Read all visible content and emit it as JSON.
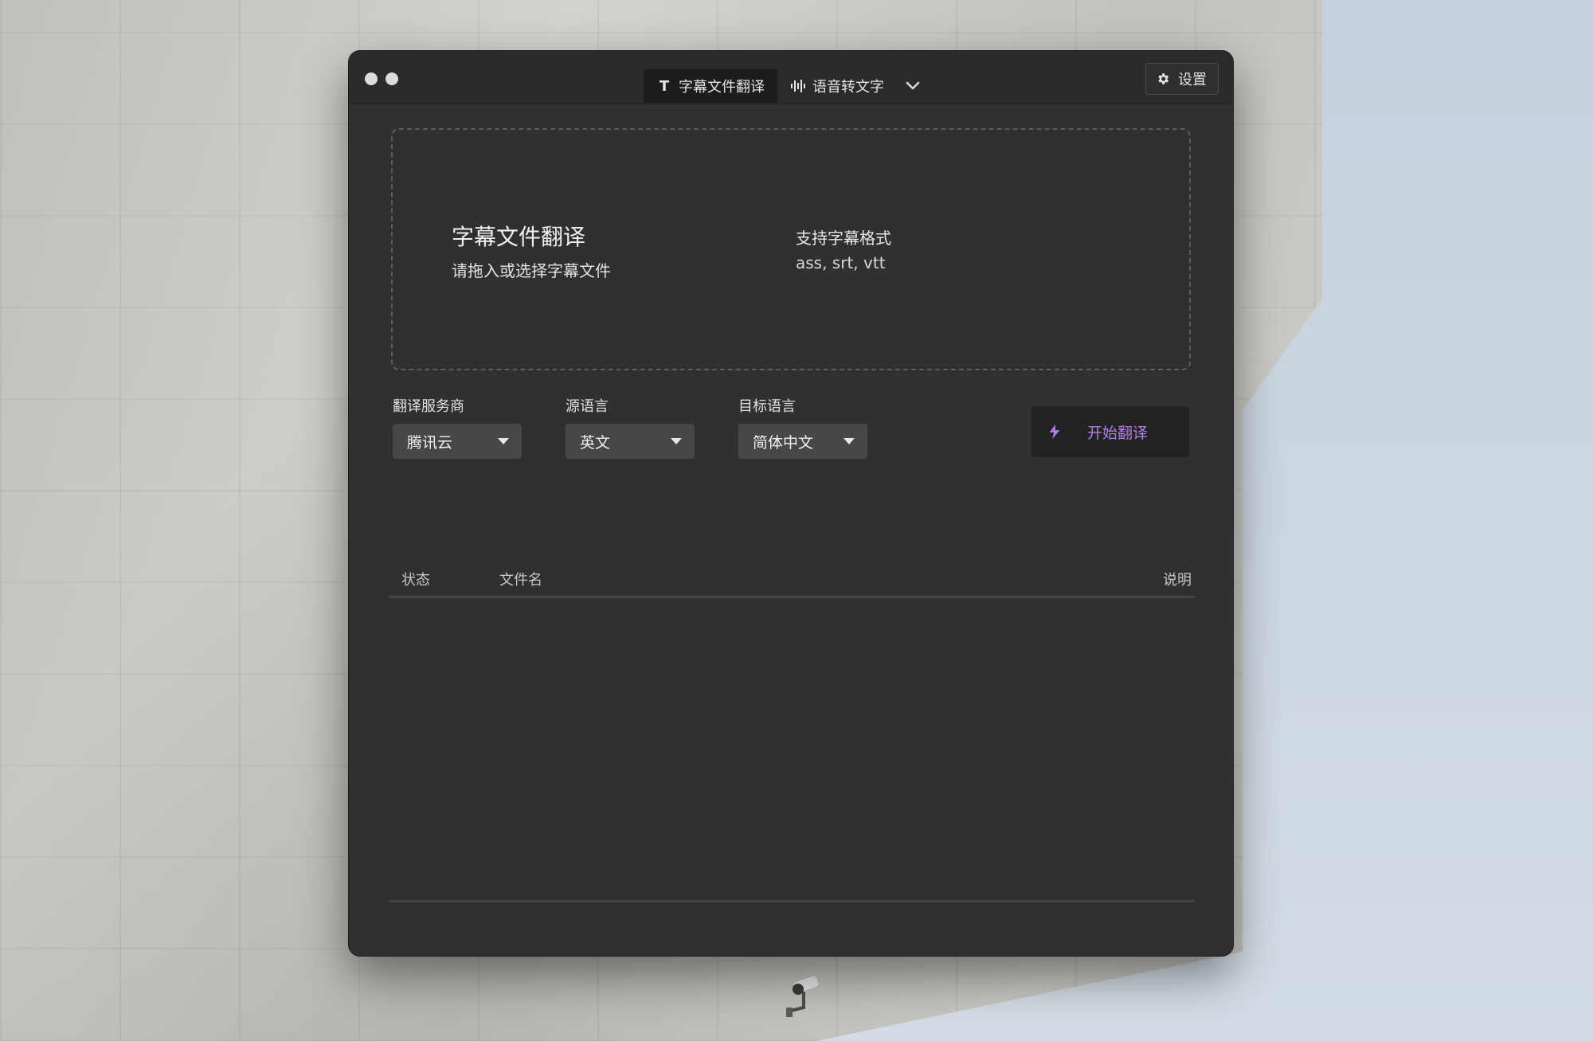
{
  "window": {
    "tabs": [
      {
        "label": "字幕文件翻译",
        "icon": "text-icon",
        "active": true
      },
      {
        "label": "语音转文字",
        "icon": "waveform-icon",
        "active": false
      }
    ],
    "more_icon": "chevron-down-icon",
    "settings": {
      "label": "设置",
      "icon": "gear-icon"
    }
  },
  "dropzone": {
    "title": "字幕文件翻译",
    "subtitle": "请拖入或选择字幕文件",
    "formats_label": "支持字幕格式",
    "formats": "ass, srt, vtt"
  },
  "options": {
    "provider": {
      "label": "翻译服务商",
      "value": "腾讯云"
    },
    "source_lang": {
      "label": "源语言",
      "value": "英文"
    },
    "target_lang": {
      "label": "目标语言",
      "value": "简体中文"
    }
  },
  "start_button": {
    "label": "开始翻译",
    "icon": "bolt-icon"
  },
  "table": {
    "columns": [
      "状态",
      "文件名",
      "说明"
    ],
    "rows": []
  },
  "colors": {
    "accent": "#b17ee3",
    "window_bg": "#303030",
    "titlebar_bg": "#2b2b2b",
    "select_bg": "#474747"
  }
}
